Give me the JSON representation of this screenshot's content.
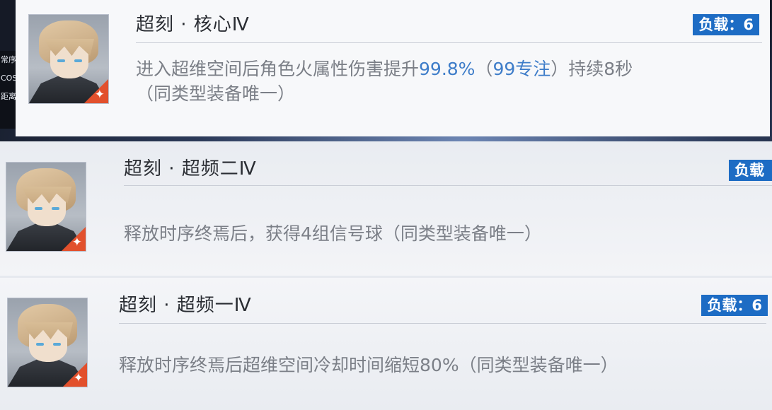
{
  "background": {
    "side_labels": [
      "常序",
      "COS",
      "距离释"
    ]
  },
  "cards": [
    {
      "title": "超刻 · 核心Ⅳ",
      "load_badge": "负载：6",
      "description": {
        "line1_pre": "进入超维空间后角色火属性伤害提升",
        "highlight1": "99.8%",
        "line1_mid": "（",
        "highlight2": "99专注",
        "line1_post": "）持续8秒",
        "line2": "（同类型装备唯一）"
      }
    },
    {
      "title": "超刻 · 超频二Ⅳ",
      "load_badge": "负载",
      "description": {
        "line1": "释放时序终焉后，获得4组信号球（同类型装备唯一）"
      }
    },
    {
      "title": "超刻 · 超频一Ⅳ",
      "load_badge": "负载：6",
      "description": {
        "line1": "释放时序终焉后超维空间冷却时间缩短80%（同类型装备唯一）"
      }
    }
  ],
  "colors": {
    "badge": "#1d6cc4",
    "highlight": "#3e7dc9",
    "corner": "#e2502c"
  }
}
